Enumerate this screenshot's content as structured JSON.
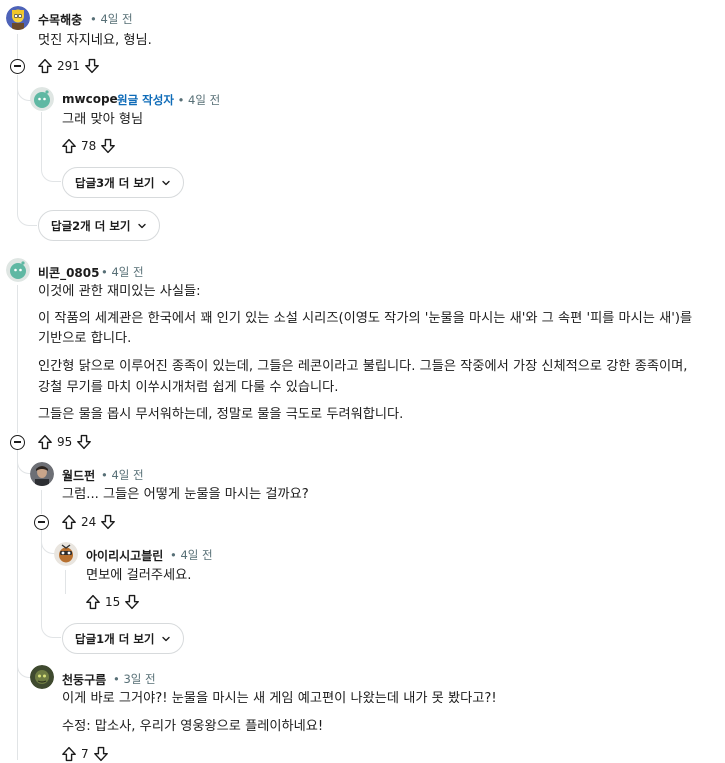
{
  "comments": [
    {
      "username": "수목해충",
      "time": "4일 전",
      "body": [
        "멋진 자지네요, 형님."
      ],
      "votes": "291",
      "reply_more": "답글2개 더 보기"
    },
    {
      "username": "mwcope",
      "op_label": "원글 작성자",
      "time": "4일 전",
      "body": [
        "그래 맞아 형님"
      ],
      "votes": "78",
      "reply_more": "답글3개 더 보기"
    },
    {
      "username": "비콘_0805",
      "time": "4일 전",
      "body": [
        "이것에 관한 재미있는 사실들:",
        "이 작품의 세계관은 한국에서 꽤 인기 있는 소설 시리즈(이영도 작가의 '눈물을 마시는 새'와 그 속편 '피를 마시는 새')를",
        "기반으로 합니다.",
        "인간형 닭으로 이루어진 종족이 있는데, 그들은 레콘이라고 불립니다. 그들은 작중에서 가장 신체적으로 강한 종족이며,",
        "강철 무기를 마치 이쑤시개처럼 쉽게 다룰 수 있습니다.",
        "그들은 물을 몹시 무서워하는데, 정말로 물을 극도로 두려워합니다."
      ],
      "votes": "95"
    },
    {
      "username": "월드펀",
      "time": "4일 전",
      "body": [
        "그럼... 그들은 어떻게 눈물을 마시는 걸까요?"
      ],
      "votes": "24",
      "reply_more": "답글1개 더 보기"
    },
    {
      "username": "아이리시고블린",
      "time": "4일 전",
      "body": [
        "면보에 걸러주세요."
      ],
      "votes": "15"
    },
    {
      "username": "천둥구름",
      "time": "3일 전",
      "body": [
        "이게 바로 그거야?! 눈물을 마시는 새 게임 예고편이 나왔는데 내가 못 봤다고?!",
        "수정: 맙소사, 우리가 영웅왕으로 플레이하네요!"
      ],
      "votes": "7"
    }
  ],
  "separator": "•",
  "colors": {
    "op_label": "#0e6bb8",
    "text": "#1c1c1c",
    "meta": "#576f76",
    "thread": "#e1e4e6"
  },
  "icons": [
    "upvote-icon",
    "downvote-icon",
    "collapse-icon",
    "chevron-down-icon"
  ]
}
